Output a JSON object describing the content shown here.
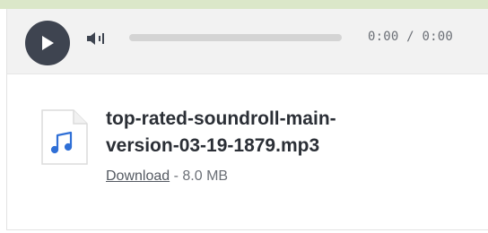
{
  "player": {
    "current_time": "0:00",
    "time_separator": "/",
    "duration": "0:00",
    "progress": 0,
    "accent_color": "#3e4450"
  },
  "file": {
    "name_line1": "top-rated-soundroll-main-",
    "name_line2": "version-03-19-1879.mp3",
    "download_label": "Download",
    "size_separator": " - ",
    "size": "8.0 MB",
    "icon": "music-file-icon",
    "icon_color": "#2f6fd6"
  },
  "icons": {
    "play": "play-icon",
    "volume": "volume-icon"
  }
}
